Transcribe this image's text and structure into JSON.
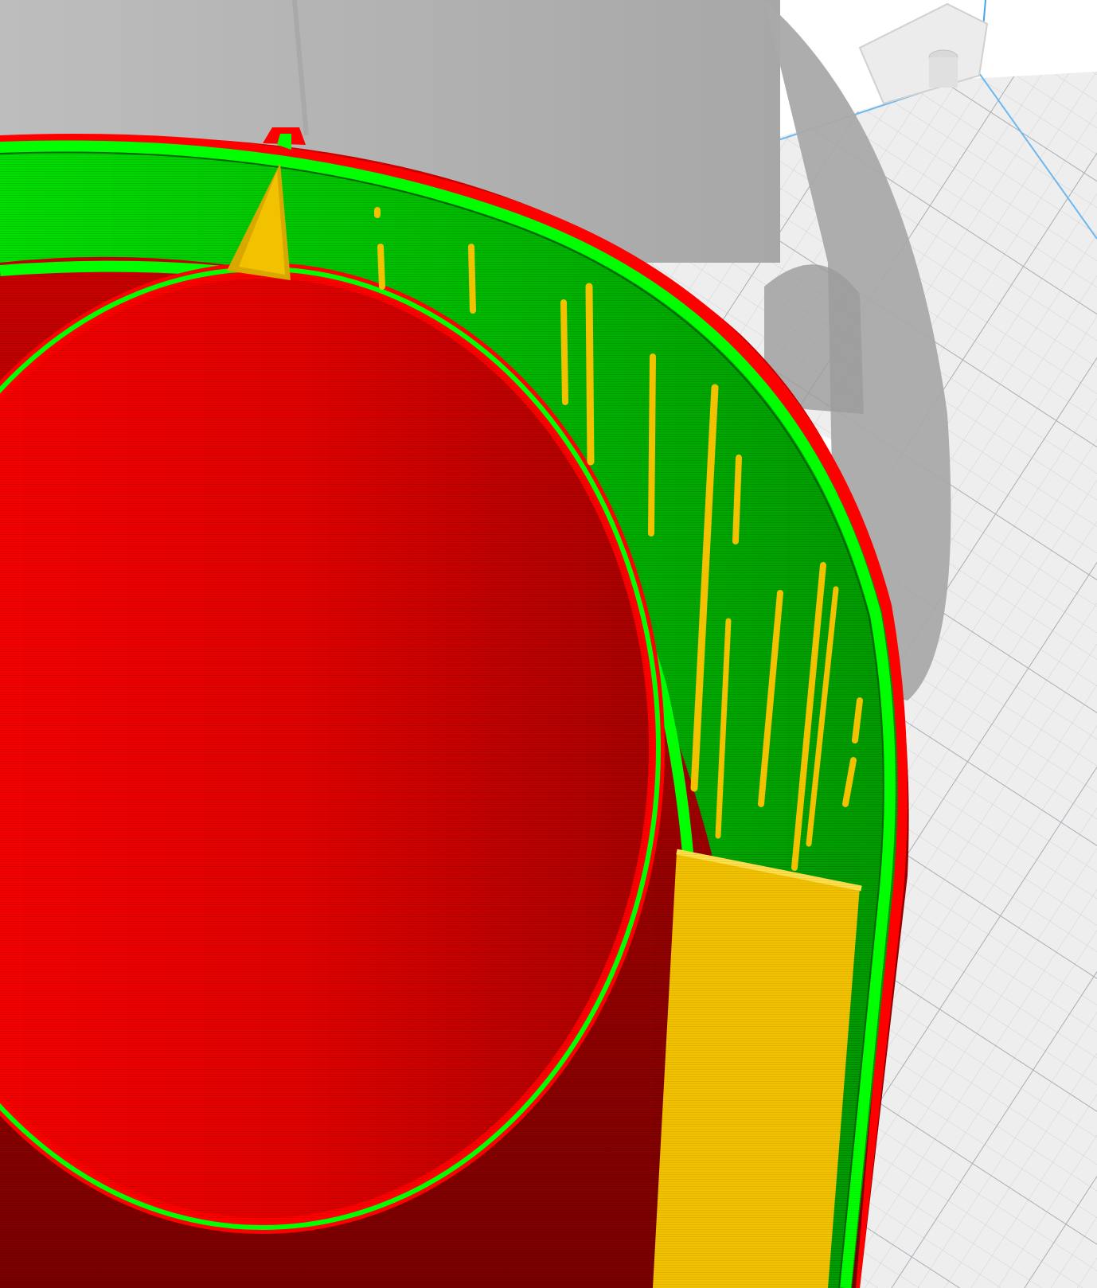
{
  "app": {
    "view": "slicer-layer-preview"
  },
  "colors": {
    "background": "#ffffff",
    "bed_surface": "#eeeeee",
    "bed_grid_minor": "#d4d4d4",
    "bed_grid_major": "#aeb4ba",
    "build_volume_edge": "#4aa3e8",
    "ghost_model": "#b9b9b9",
    "ghost_model_dark": "#9e9e9e",
    "outer_wall": "#ff0000",
    "outer_wall_dark": "#b80000",
    "inner_wall": "#00cc00",
    "inner_wall_bright": "#00ff00",
    "support_fill": "#f2c200",
    "support_highlight": "#ffe04a"
  },
  "legend": {
    "outer_wall_feature": "outer-wall",
    "inner_wall_feature": "inner-wall",
    "support_feature": "support"
  },
  "icons": {
    "build_plate": "build-plate-icon",
    "print_model": "print-model-icon"
  }
}
